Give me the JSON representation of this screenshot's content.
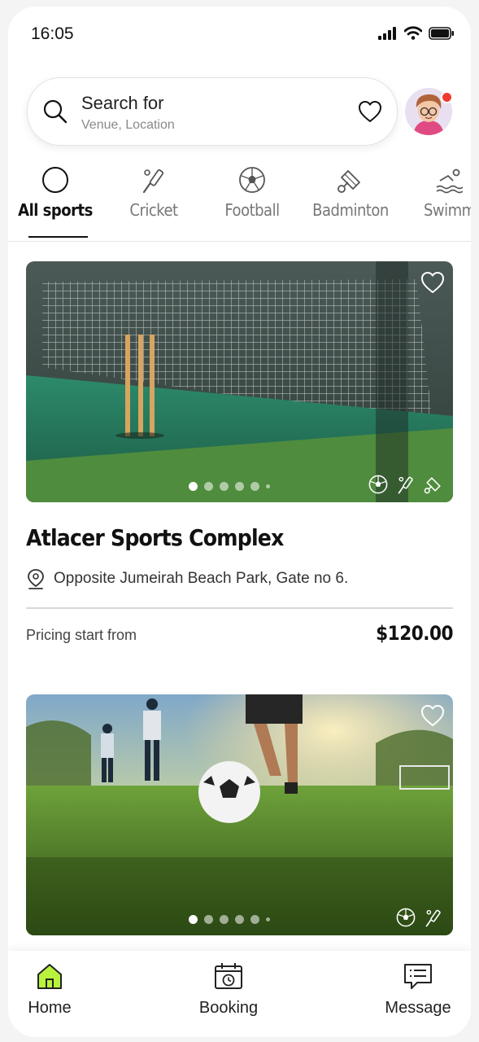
{
  "status_bar": {
    "time": "16:05"
  },
  "search": {
    "title": "Search for",
    "placeholder": "Venue, Location"
  },
  "categories": [
    {
      "label": "All sports",
      "icon": "circle-icon",
      "active": true
    },
    {
      "label": "Cricket",
      "icon": "cricket-bat-icon"
    },
    {
      "label": "Football",
      "icon": "football-icon"
    },
    {
      "label": "Badminton",
      "icon": "shuttlecock-icon"
    },
    {
      "label": "Swimmin",
      "icon": "swimming-icon"
    }
  ],
  "venues": [
    {
      "name": "Atlacer Sports Complex",
      "address": "Opposite Jumeirah Beach Park, Gate no 6.",
      "pricing_label": "Pricing start from",
      "price": "$120.00",
      "sports": [
        "football-icon",
        "cricket-bat-icon",
        "shuttlecock-icon"
      ]
    },
    {
      "sports": [
        "football-icon",
        "cricket-bat-icon"
      ]
    }
  ],
  "bottom_nav": [
    {
      "label": "Home",
      "icon": "home-icon",
      "active": true
    },
    {
      "label": "Booking",
      "icon": "calendar-clock-icon"
    },
    {
      "label": "Message",
      "icon": "message-icon"
    }
  ],
  "colors": {
    "accent": "#b8f23c",
    "notification": "#f03a2e"
  }
}
